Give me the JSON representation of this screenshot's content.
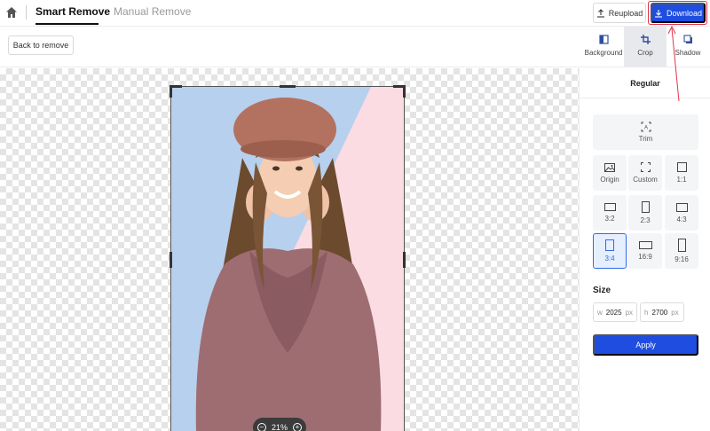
{
  "header": {
    "tab_smart": "Smart Remove",
    "tab_manual": "Manual Remove",
    "reupload_label": "Reupload",
    "download_label": "Download"
  },
  "toolbar": {
    "back_label": "Back to remove",
    "tools": [
      {
        "label": "Background",
        "icon": "background-icon"
      },
      {
        "label": "Crop",
        "icon": "crop-icon",
        "active": true
      },
      {
        "label": "Shadow",
        "icon": "shadow-icon"
      }
    ]
  },
  "canvas": {
    "zoom": "21%"
  },
  "panel": {
    "mode": "Regular",
    "trim_label": "Trim",
    "ratios": [
      {
        "label": "Origin"
      },
      {
        "label": "Custom"
      },
      {
        "label": "1:1"
      },
      {
        "label": "3:2"
      },
      {
        "label": "2:3"
      },
      {
        "label": "4:3"
      },
      {
        "label": "3:4",
        "selected": true
      },
      {
        "label": "16:9"
      },
      {
        "label": "9:16"
      }
    ],
    "size_label": "Size",
    "width_prefix": "w",
    "width_value": "2025",
    "height_prefix": "h",
    "height_value": "2700",
    "unit": "px",
    "apply_label": "Apply"
  },
  "colors": {
    "accent": "#1e4de0",
    "highlight": "#e0334a",
    "selected_bg": "#e6effd"
  }
}
